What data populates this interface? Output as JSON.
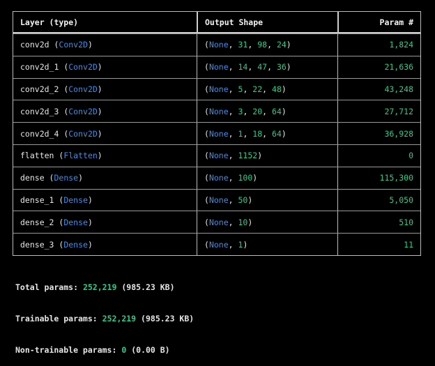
{
  "colors": {
    "background": "#000000",
    "text": "#e6e6e6",
    "class_name": "#3b8eea",
    "number": "#23d18b",
    "border": "#bdbdbd"
  },
  "header": {
    "layer": "Layer (type)",
    "output_shape": "Output Shape",
    "params": "Param #"
  },
  "layers": [
    {
      "name": "conv2d",
      "type": "Conv2D",
      "shape": [
        "None",
        "31",
        "98",
        "24"
      ],
      "params": "1,824"
    },
    {
      "name": "conv2d_1",
      "type": "Conv2D",
      "shape": [
        "None",
        "14",
        "47",
        "36"
      ],
      "params": "21,636"
    },
    {
      "name": "conv2d_2",
      "type": "Conv2D",
      "shape": [
        "None",
        "5",
        "22",
        "48"
      ],
      "params": "43,248"
    },
    {
      "name": "conv2d_3",
      "type": "Conv2D",
      "shape": [
        "None",
        "3",
        "20",
        "64"
      ],
      "params": "27,712"
    },
    {
      "name": "conv2d_4",
      "type": "Conv2D",
      "shape": [
        "None",
        "1",
        "18",
        "64"
      ],
      "params": "36,928"
    },
    {
      "name": "flatten",
      "type": "Flatten",
      "shape": [
        "None",
        "1152"
      ],
      "params": "0"
    },
    {
      "name": "dense",
      "type": "Dense",
      "shape": [
        "None",
        "100"
      ],
      "params": "115,300"
    },
    {
      "name": "dense_1",
      "type": "Dense",
      "shape": [
        "None",
        "50"
      ],
      "params": "5,050"
    },
    {
      "name": "dense_2",
      "type": "Dense",
      "shape": [
        "None",
        "10"
      ],
      "params": "510"
    },
    {
      "name": "dense_3",
      "type": "Dense",
      "shape": [
        "None",
        "1"
      ],
      "params": "11"
    }
  ],
  "totals": {
    "total": {
      "label": "Total params:",
      "value": "252,219",
      "size": "(985.23 KB)"
    },
    "trainable": {
      "label": "Trainable params:",
      "value": "252,219",
      "size": "(985.23 KB)"
    },
    "non_trainable": {
      "label": "Non-trainable params:",
      "value": "0",
      "size": "(0.00 B)"
    }
  }
}
